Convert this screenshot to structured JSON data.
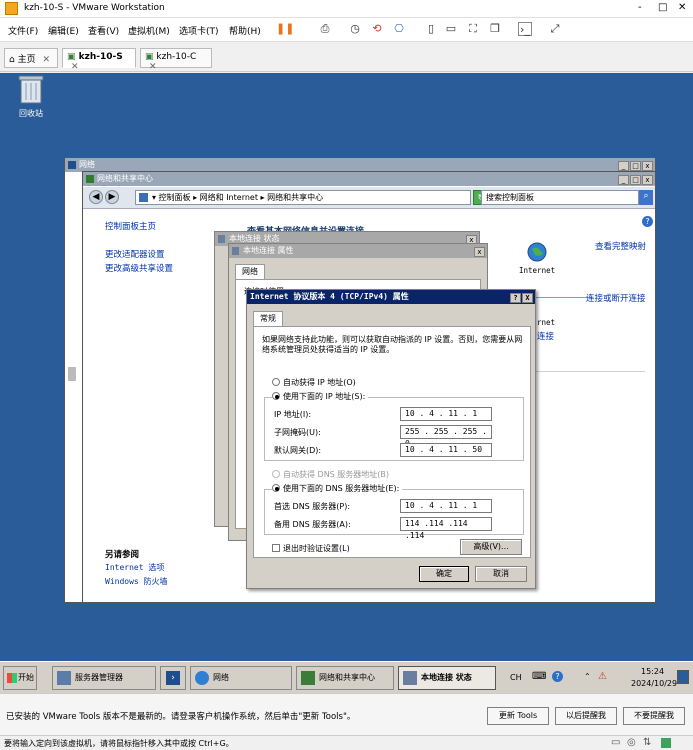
{
  "vmware": {
    "title": "kzh-10-S - VMware Workstation",
    "win_controls": [
      "-",
      "□",
      "✕"
    ],
    "menu": [
      "文件(F)",
      "编辑(E)",
      "查看(V)",
      "虚拟机(M)",
      "选项卡(T)",
      "帮助(H)"
    ],
    "tabs": [
      {
        "label": "主页",
        "active": false
      },
      {
        "label": "kzh-10-S",
        "active": true
      },
      {
        "label": "kzh-10-C",
        "active": false
      }
    ]
  },
  "desktop": {
    "recycle_bin": "回收站"
  },
  "network_window": {
    "title": "网络"
  },
  "sharing_center": {
    "title": "网络和共享中心",
    "breadcrumb": "▾ 控制面板 ▸ 网络和 Internet ▸ 网络和共享中心",
    "search_placeholder": "搜索控制面板",
    "sidebar": [
      "控制面板主页",
      "更改适配器设置",
      "更改高级共享设置"
    ],
    "heading": "查看基本网络信息并设置连接",
    "map_link": "查看完整映射",
    "internet_label": "Internet",
    "connect_link": "连接或断开连接",
    "partial_net": "rnet",
    "partial_link": "连接",
    "see_also": "另请参阅",
    "see_also_links": [
      "Internet 选项",
      "Windows 防火墙"
    ]
  },
  "status_dialog": {
    "title": "本地连接 状态"
  },
  "props_dialog": {
    "title": "本地连接 属性",
    "tab": "网络",
    "partial_text": "连接时使用:"
  },
  "ipv4_dialog": {
    "title": "Internet 协议版本 4 (TCP/IPv4) 属性",
    "title_btns": [
      "?",
      "X"
    ],
    "tab": "常规",
    "desc": "如果网络支持此功能，则可以获取自动指派的 IP 设置。否则，您需要从网络系统管理员处获得适当的 IP 设置。",
    "auto_ip": "自动获得 IP 地址(O)",
    "manual_ip": "使用下面的 IP 地址(S):",
    "ip_label": "IP 地址(I):",
    "ip_value": "10 . 4 . 11 . 1",
    "mask_label": "子网掩码(U):",
    "mask_value": "255 . 255 . 255 . 0",
    "gw_label": "默认网关(D):",
    "gw_value": "10 . 4 . 11 . 50",
    "auto_dns": "自动获得 DNS 服务器地址(B)",
    "manual_dns": "使用下面的 DNS 服务器地址(E):",
    "dns1_label": "首选 DNS 服务器(P):",
    "dns1_value": "10 . 4 . 11 . 1",
    "dns2_label": "备用 DNS 服务器(A):",
    "dns2_value": "114 .114 .114 .114",
    "validate": "退出时验证设置(L)",
    "advanced": "高级(V)...",
    "ok": "确定",
    "cancel": "取消"
  },
  "taskbar": {
    "start": "开始",
    "items": [
      "服务器管理器",
      "",
      "网络",
      "网络和共享中心",
      "本地连接 状态"
    ],
    "lang": "CH",
    "time": "15:24",
    "date": "2024/10/29"
  },
  "notify": {
    "message": "已安装的 VMware Tools 版本不是最新的。请登录客户机操作系统，然后单击\"更新 Tools\"。",
    "buttons": [
      "更新 Tools",
      "以后提醒我",
      "不要提醒我"
    ]
  },
  "statusbar": {
    "text": "要将输入定向到该虚拟机，请将鼠标指针移入其中或按 Ctrl+G。"
  },
  "colors": {
    "desktop": "#2a5c9a",
    "active_title": "#0a246a",
    "link": "#0033aa",
    "pause_accent": "#e8731a"
  }
}
